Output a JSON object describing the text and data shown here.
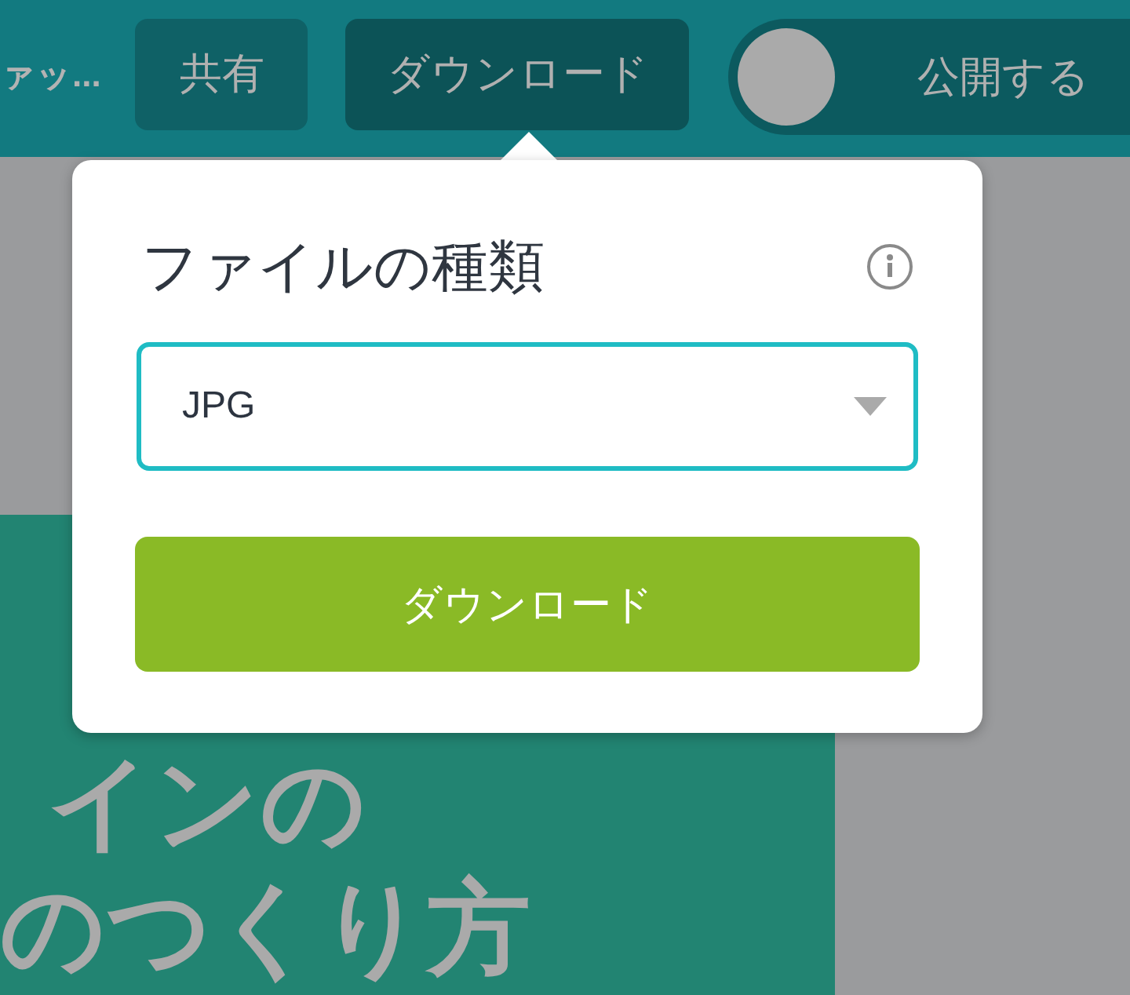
{
  "toolbar": {
    "truncated_label": "ァッ...",
    "buttons": [
      {
        "label": "共有",
        "selected": false
      },
      {
        "label": "ダウンロード",
        "selected": true
      }
    ],
    "publish_toggle": {
      "label": "公開する",
      "on": false
    }
  },
  "download_popover": {
    "title": "ファイルの種類",
    "file_type_select": {
      "value": "JPG"
    },
    "download_button": {
      "label": "ダウンロード"
    }
  },
  "canvas": {
    "heading_lines": [
      "インの",
      "のつくり方"
    ]
  }
}
